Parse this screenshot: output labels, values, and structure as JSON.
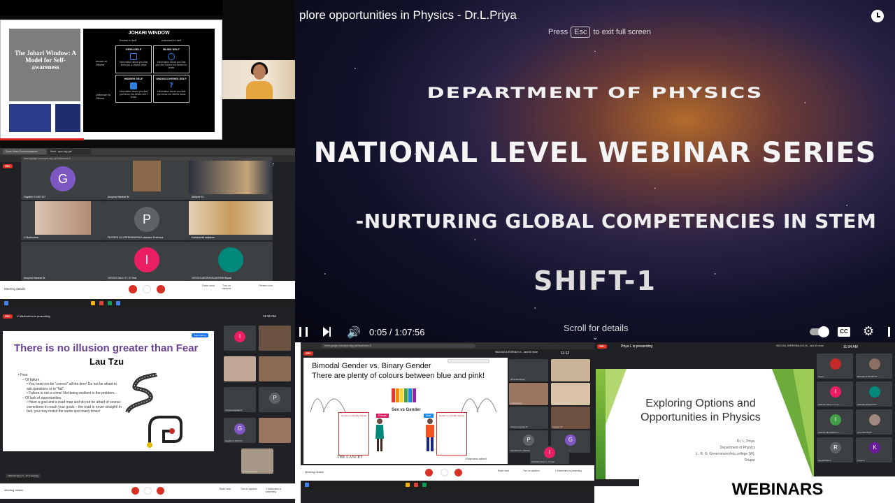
{
  "johari": {
    "slide_title": "The Johari Window: A Model for Self-awareness",
    "window_heading": "JOHARI WINDOW",
    "known_to_self": "Known to self",
    "unknown_to_self": "unknown to self",
    "known_to_others": "known to Others",
    "unknown_to_others": "Unknown to Others",
    "open_self": "OPEN SELF",
    "open_desc": "Information about you that both you & others know",
    "blind_self": "BLIND SELF",
    "blind_desc": "Information about you that you don't know but others do know",
    "hidden_self": "HIDDEN SELF",
    "hidden_desc": "Information about you that you know but others don't know",
    "undiscovered_self": "UNDISCOVERED SELF",
    "undiscovered_desc": "Information about you that you know nor others know"
  },
  "meet_grid": {
    "tab1": "Zoom Video Communications",
    "tab2": "Meet - apm-vkjy-ykf",
    "url": "meet.google.com/apm-vkjy-ykf?authuser=0",
    "rec": "REC",
    "clock": "11:07",
    "presenting": "9821016-Dinasank Rathi M and 58 more",
    "tiles": [
      {
        "name": "Gayathri S 1907107",
        "initial": "G",
        "color": "#7e57c2"
      },
      {
        "name": "Anupma Harshal W.",
        "initial": "",
        "color": ""
      },
      {
        "name": "Abhjeet KV",
        "initial": "",
        "color": ""
      },
      {
        "name": "V Madhurima",
        "initial": "",
        "color": ""
      },
      {
        "name": "PHYSICS Dr V.RENGANAYAKI Assistant Professor",
        "initial": "P",
        "color": "#5f6368"
      },
      {
        "name": "Kanakavalli sankaran",
        "initial": "",
        "color": ""
      },
      {
        "name": "Anupma Harshal W.",
        "initial": "",
        "color": ""
      },
      {
        "name": "1921319 VALLI V - III Year",
        "initial": "I",
        "color": "#e91e63"
      },
      {
        "name": "1921319-AKSHAYALAKSHMI Biyaar",
        "initial": "",
        "color": "#00897b"
      }
    ],
    "meeting_details": "Meeting details",
    "raise_hand": "Raise hand",
    "captions": "Turn on captions",
    "present_now": "Present now"
  },
  "youtube": {
    "title": "plore opportunities in Physics - Dr.L.Priya",
    "press": "Press",
    "esc": "Esc",
    "exit_full": "to exit full screen",
    "line1": "DEPARTMENT OF PHYSICS",
    "line2": "NATIONAL LEVEL WEBINAR SERIES",
    "line3": "-NURTURING GLOBAL COMPETENCIES IN STEM",
    "line4": "SHIFT-1",
    "time": "0:05 / 1:07:56",
    "scroll": "Scroll for details",
    "cc": "CC",
    "progress": 0.001
  },
  "fear": {
    "rec": "REC",
    "presenting": "V Madhurima is presenting",
    "clock": "11:16 AM",
    "stop_btn": "Stop sharing",
    "heading": "There is no illusion greater than Fear",
    "author": "Lau Tzu",
    "bullets": [
      {
        "level": 0,
        "text": "• Fear"
      },
      {
        "level": 1,
        "text": "– Of failure"
      },
      {
        "level": 2,
        "text": "• You need not be \"correct\" all the time! Do not be afraid to ask questions or to \"fail\"."
      },
      {
        "level": 2,
        "text": "• Failure is not a crime! Not being resilient is the problem."
      },
      {
        "level": 1,
        "text": "– Of lack of opportunities"
      },
      {
        "level": 2,
        "text": "• Have a goal and a road map and do not be afraid of course-corrections to reach your goals – the road is never straight! In fact, you may revisit the same spot many times!"
      }
    ],
    "side_tiles": [
      {
        "name": "",
        "initial": "I",
        "color": "#e91e63"
      },
      {
        "name": "",
        "initial": "",
        "color": ""
      },
      {
        "name": "",
        "initial": "",
        "color": ""
      },
      {
        "name": "",
        "initial": "",
        "color": ""
      },
      {
        "name": "Anupma Harshal W.",
        "initial": "",
        "color": ""
      },
      {
        "name": "",
        "initial": "P",
        "color": "#5f6368"
      },
      {
        "name": "Gayathri S 1907107",
        "initial": "G",
        "color": "#7e57c2"
      },
      {
        "name": "",
        "initial": "",
        "color": ""
      },
      {
        "name": "uthra dinesingan",
        "initial": "",
        "color": ""
      }
    ],
    "caption": "1921319 VALLI V - III Yr Hashtag",
    "meeting_details": "Meeting details",
    "raise": "Raise hand",
    "captions": "Turn on captions",
    "present": "V Madhurima is presenting"
  },
  "gender": {
    "url": "meet.google.com/apm-vkjy-ykf?authuser=0",
    "rec": "REC",
    "presenting": "9821033-STEVENA K K... and 50 more",
    "clock": "11:12",
    "heading1": "Bimodal Gender vs. Binary Gender",
    "heading2": "There are plenty of colours between blue and pink!",
    "sex_vs_gender": "Sex vs Gender",
    "female": "Female",
    "male": "Male",
    "box_left": "Gender is culturally defined",
    "box_right": "Gender is culturally defined",
    "lancet": "THE LANCET",
    "emphasis": "Emphasis added",
    "side_tiles": [
      {
        "name": "uthra dinesingan",
        "initial": "",
        "color": ""
      },
      {
        "name": "",
        "initial": "",
        "color": ""
      },
      {
        "name": "V Madhurima",
        "initial": "",
        "color": ""
      },
      {
        "name": "Kanakavalli sankaran",
        "initial": "",
        "color": ""
      },
      {
        "name": "Anupma Harshal W.",
        "initial": "",
        "color": ""
      },
      {
        "name": "Shankar KV",
        "initial": "",
        "color": ""
      },
      {
        "name": "PHYSICS Dr V.RENGANA...",
        "initial": "P",
        "color": "#5f6368"
      },
      {
        "name": "Gayathri S 1907107",
        "initial": "G",
        "color": "#7e57c2"
      },
      {
        "name": "1921319 VALLI V - III Year",
        "initial": "I",
        "color": "#e91e63"
      }
    ],
    "meeting_details": "Meeting details",
    "raise": "Raise hand",
    "captions": "Turn on captions",
    "presenting_bottom": "V Madhurima is presenting"
  },
  "options": {
    "rec": "REC",
    "presenting": "Priya L is presenting",
    "info": "9821016_SHREEBALA B_M... and 49 more",
    "clock": "11:04 AM",
    "title": "Exploring Options and Opportunities in Physics",
    "sub1": "Dr. L. Priya,",
    "sub2": "Department of Physics",
    "sub3": "L. R. G. Government Arts college (W),",
    "sub4": "Tirupur",
    "side_tiles": [
      {
        "name": "Priya L",
        "initial": "",
        "color": ""
      },
      {
        "name": "9821030-THAGARAJA...",
        "initial": "",
        "color": ""
      },
      {
        "name": "1921319 VALLI V- III Ye...",
        "initial": "I",
        "color": "#e91e63"
      },
      {
        "name": "1921319-AKSHAYALA...",
        "initial": "",
        "color": "#00897b"
      },
      {
        "name": "1921342-BHOOMIKA S...",
        "initial": "I",
        "color": "#43a047"
      },
      {
        "name": "uthra dinesingan",
        "initial": "",
        "color": ""
      },
      {
        "name": "Ranganayaki V",
        "initial": "R",
        "color": "#5f6368"
      },
      {
        "name": "Kothai K",
        "initial": "K",
        "color": "#6a1b9a"
      }
    ]
  },
  "label": "WEBINARS"
}
